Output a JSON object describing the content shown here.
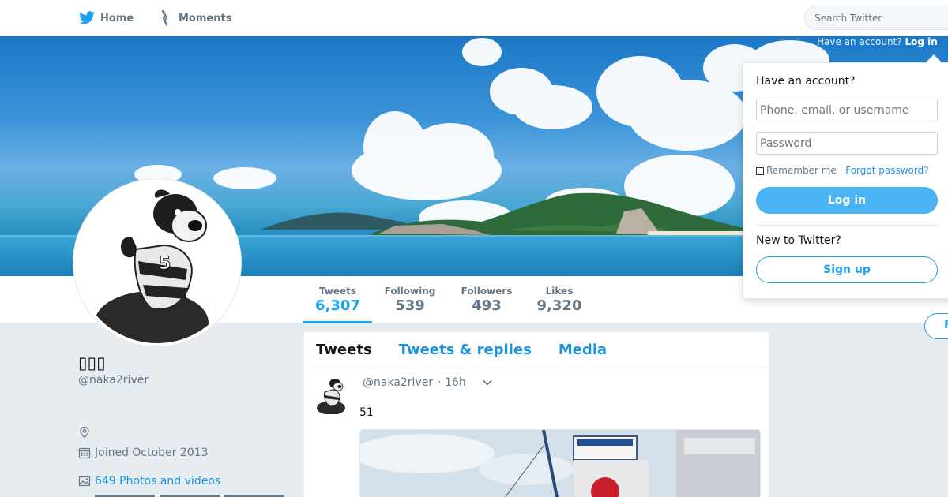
{
  "nav": {
    "home_label": "Home",
    "moments_label": "Moments",
    "search_placeholder": "Search Twitter"
  },
  "account_hint": {
    "text": "Have an account?",
    "login_label": "Log in"
  },
  "profile": {
    "name": "▯▯▯",
    "handle": "@naka2river",
    "joined": "Joined October 2013",
    "photos_videos": "649 Photos and videos"
  },
  "stats": [
    {
      "label": "Tweets",
      "value": "6,307"
    },
    {
      "label": "Following",
      "value": "539"
    },
    {
      "label": "Followers",
      "value": "493"
    },
    {
      "label": "Likes",
      "value": "9,320"
    }
  ],
  "timeline": {
    "tabs": [
      "Tweets",
      "Tweets & replies",
      "Media"
    ],
    "tweet": {
      "handle": "@naka2river",
      "time": "· 16h",
      "text": "51"
    }
  },
  "login_dropdown": {
    "title": "Have an account?",
    "username_placeholder": "Phone, email, or username",
    "password_placeholder": "Password",
    "remember_label": "Remember me",
    "separator": " · ",
    "forgot_label": "Forgot password?",
    "login_button": "Log in",
    "new_label": "New to Twitter?",
    "signup_button": "Sign up"
  },
  "colors": {
    "accent": "#1da1f2",
    "link": "#1b95e0",
    "login_button": "#4ab3f4",
    "page_bg": "#e6ecf0"
  }
}
